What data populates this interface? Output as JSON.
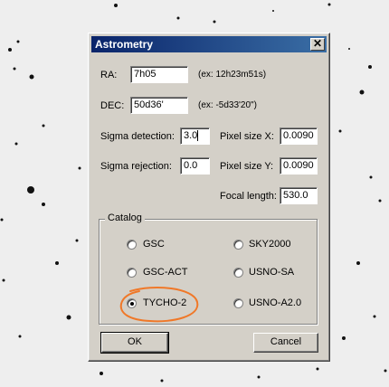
{
  "window": {
    "title": "Astrometry",
    "close_symbol": "✕"
  },
  "fields": {
    "ra": {
      "label": "RA:",
      "value": "7h05",
      "example": "(ex: 12h23m51s)"
    },
    "dec": {
      "label": "DEC:",
      "value": "50d36'",
      "example": "(ex: -5d33'20\")"
    },
    "sigma_detection": {
      "label": "Sigma detection:",
      "value": "3.0"
    },
    "sigma_rejection": {
      "label": "Sigma rejection:",
      "value": "0.0"
    },
    "pixel_size_x": {
      "label": "Pixel size X:",
      "value": "0.0090"
    },
    "pixel_size_y": {
      "label": "Pixel size Y:",
      "value": "0.0090"
    },
    "focal_length": {
      "label": "Focal length:",
      "value": "530.0"
    }
  },
  "catalog": {
    "legend": "Catalog",
    "options": [
      "GSC",
      "SKY2000",
      "GSC-ACT",
      "USNO-SA",
      "TYCHO-2",
      "USNO-A2.0"
    ],
    "selected": "TYCHO-2"
  },
  "buttons": {
    "ok": "OK",
    "cancel": "Cancel"
  },
  "colors": {
    "dialog_bg": "#d4d0c8",
    "titlebar_start": "#0a246a",
    "titlebar_end": "#3a6ea5",
    "highlight_annotation": "#f07828"
  }
}
